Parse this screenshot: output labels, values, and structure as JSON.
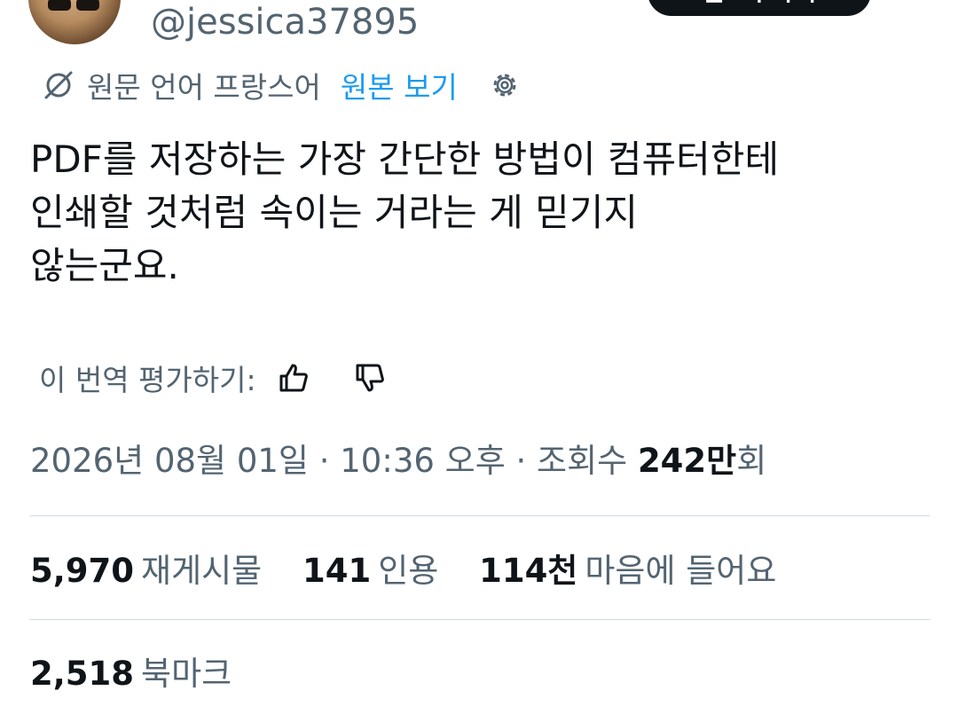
{
  "author": {
    "handle": "@jessica37895"
  },
  "header": {
    "follow_label": "팔로우하기"
  },
  "translation": {
    "original_language": "원문 언어 프랑스어",
    "view_original": "원본 보기"
  },
  "tweet": {
    "lines": [
      "PDF를 저장하는 가장 간단한 방법이 컴퓨터한테",
      "인쇄할 것처럼 속이는 거라는 게 믿기지",
      "않는군요."
    ]
  },
  "rating": {
    "label": "이 번역 평가하기:"
  },
  "meta": {
    "date": "2026년 08월 01일",
    "separator": "·",
    "time": "10:36 오후",
    "views_prefix": "조회수",
    "views_value": "242만",
    "views_suffix": "회"
  },
  "stats": {
    "reposts": {
      "value": "5,970",
      "label": "재게시물"
    },
    "quotes": {
      "value": "141",
      "label": "인용"
    },
    "likes": {
      "value": "114천",
      "label": "마음에 들어요"
    },
    "bookmarks": {
      "value": "2,518",
      "label": "북마크"
    }
  },
  "icons": {
    "translate": "translate-icon",
    "settings": "gear-icon",
    "thumbs_up": "thumbs-up-icon",
    "thumbs_down": "thumbs-down-icon"
  },
  "colors": {
    "text_primary": "#0f1419",
    "text_secondary": "#536471",
    "link": "#1d9bf0",
    "divider": "#cfd9de"
  }
}
